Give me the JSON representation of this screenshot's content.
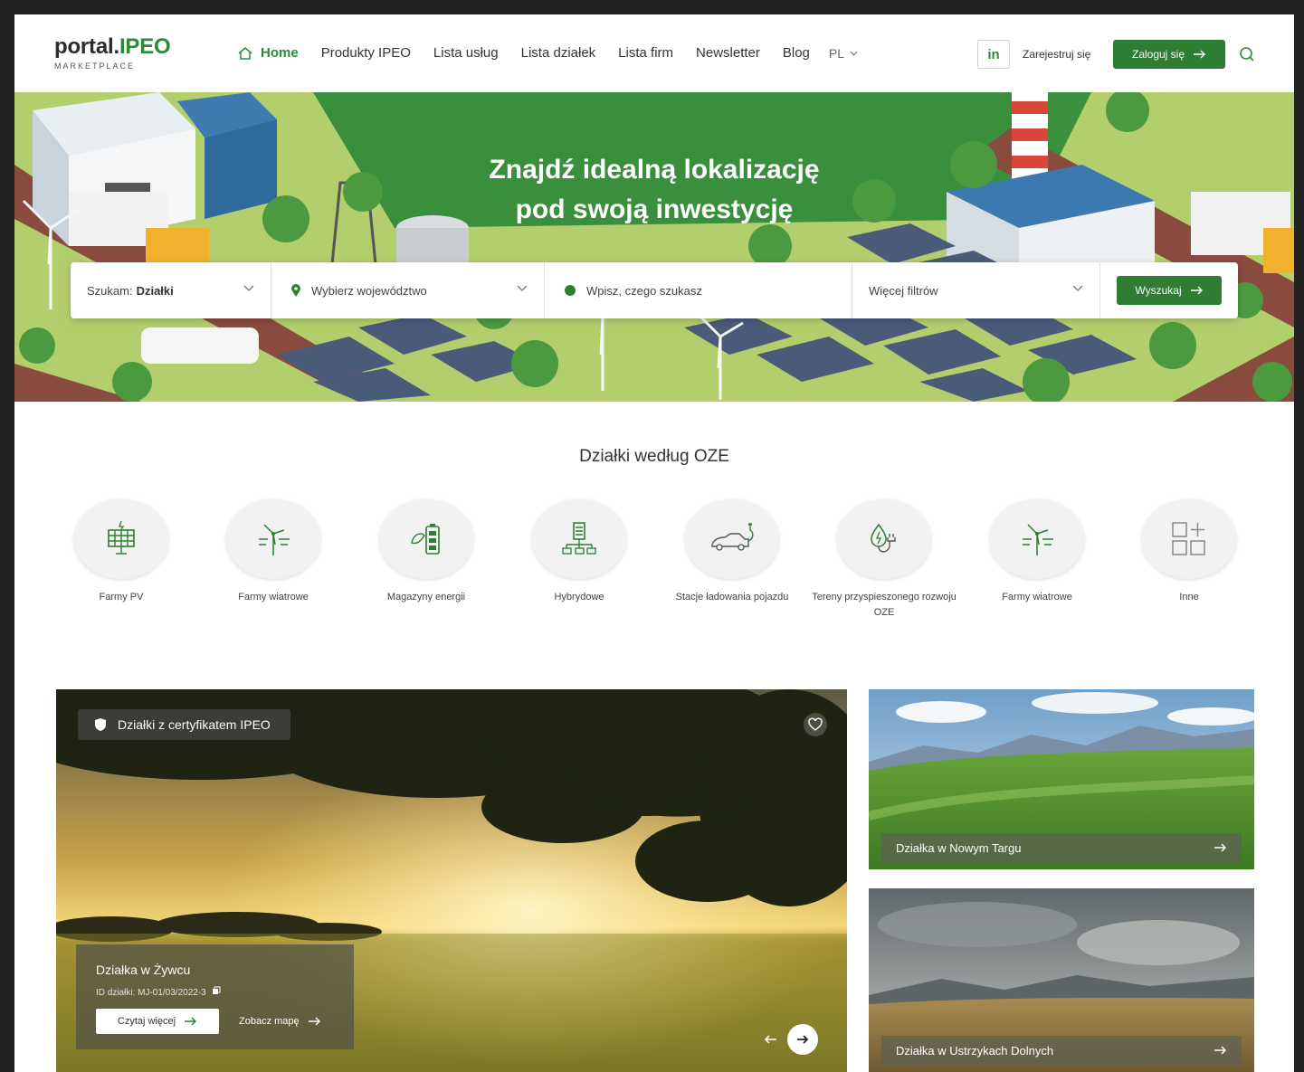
{
  "header": {
    "logo_main": "portal.",
    "logo_brand": "IPEO",
    "logo_sub": "MARKETPLACE",
    "nav": [
      {
        "label": "Home"
      },
      {
        "label": "Produkty IPEO"
      },
      {
        "label": "Lista usług"
      },
      {
        "label": "Lista działek"
      },
      {
        "label": "Lista firm"
      },
      {
        "label": "Newsletter"
      },
      {
        "label": "Blog"
      }
    ],
    "lang": "PL",
    "linkedin": "in",
    "register": "Zarejestruj się",
    "login": "Zaloguj się"
  },
  "hero": {
    "title_line1": "Znajdź idealną lokalizację",
    "title_line2": "pod swoją inwestycję"
  },
  "search": {
    "type_label": "Szukam:",
    "type_value": "Działki",
    "region_placeholder": "Wybierz województwo",
    "query_placeholder": "Wpisz, czego szukasz",
    "filters_label": "Więcej filtrów",
    "button": "Wyszukaj"
  },
  "categories": {
    "title": "Działki według OZE",
    "items": [
      {
        "label": "Farmy PV",
        "icon": "solar-panel-icon"
      },
      {
        "label": "Farmy wiatrowe",
        "icon": "wind-turbine-icon"
      },
      {
        "label": "Magazyny energii",
        "icon": "battery-icon"
      },
      {
        "label": "Hybrydowe",
        "icon": "hybrid-icon"
      },
      {
        "label": "Stacje ładowania pojazdu",
        "icon": "ev-charging-icon"
      },
      {
        "label": "Tereny przyspieszonego rozwoju OZE",
        "icon": "energy-plug-icon"
      },
      {
        "label": "Farmy wiatrowe",
        "icon": "wind-turbine-icon"
      },
      {
        "label": "Inne",
        "icon": "grid-plus-icon"
      }
    ]
  },
  "featured": {
    "badge": "Działki z certyfikatem IPEO",
    "title": "Działka w Żywcu",
    "id_text": "ID działki: MJ-01/03/2022-3",
    "read_more": "Czytaj więcej",
    "see_map": "Zobacz mapę"
  },
  "side_cards": [
    {
      "title": "Działka w Nowym Targu"
    },
    {
      "title": "Działka w Ustrzykach Dolnych"
    }
  ],
  "colors": {
    "brand_green": "#2e7d32",
    "hero_green": "#3a8f3d"
  }
}
